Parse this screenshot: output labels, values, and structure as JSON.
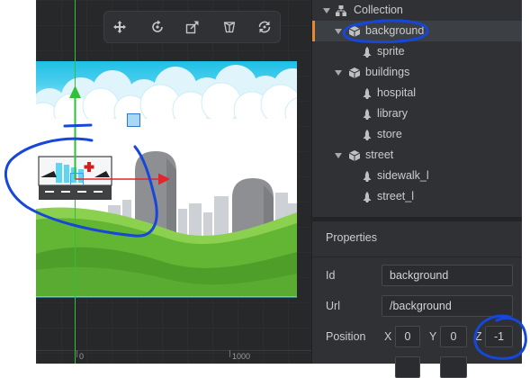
{
  "toolbar": {
    "icons": [
      "move-icon",
      "rotate-icon",
      "scale-icon",
      "perspective-icon",
      "refresh-icon"
    ]
  },
  "scene": {
    "ruler_labels": [
      "0",
      "1000"
    ]
  },
  "outline": {
    "root": {
      "label": "Collection",
      "icon": "collection-icon",
      "expanded": true,
      "children": [
        {
          "label": "background",
          "icon": "game-object-icon",
          "expanded": true,
          "selected": true,
          "children": [
            {
              "label": "sprite",
              "icon": "component-icon"
            }
          ]
        },
        {
          "label": "buildings",
          "icon": "game-object-icon",
          "expanded": true,
          "children": [
            {
              "label": "hospital",
              "icon": "component-icon"
            },
            {
              "label": "library",
              "icon": "component-icon"
            },
            {
              "label": "store",
              "icon": "component-icon"
            }
          ]
        },
        {
          "label": "street",
          "icon": "game-object-icon",
          "expanded": true,
          "children": [
            {
              "label": "sidewalk_l",
              "icon": "component-icon"
            },
            {
              "label": "street_l",
              "icon": "component-icon"
            }
          ]
        }
      ]
    }
  },
  "properties": {
    "title": "Properties",
    "id": {
      "label": "Id",
      "value": "background"
    },
    "url": {
      "label": "Url",
      "value": "/background"
    },
    "position": {
      "label": "Position",
      "x_label": "X",
      "x": "0",
      "y_label": "Y",
      "y": "0",
      "z_label": "Z",
      "z": "-1"
    }
  },
  "colors": {
    "selection_accent": "#e8892c",
    "gizmo_x": "#e3242b",
    "gizmo_y": "#2fc13a",
    "annotation_ink": "#1747d9",
    "panel_bg": "#2f3134"
  }
}
